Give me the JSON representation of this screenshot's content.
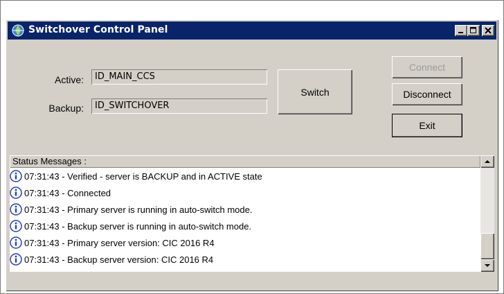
{
  "window": {
    "title": "Switchover Control Panel"
  },
  "titlebar_buttons": {
    "minimize": "minimize",
    "maximize": "maximize",
    "close": "close"
  },
  "form": {
    "active_label": "Active:",
    "active_value": "ID_MAIN_CCS",
    "backup_label": "Backup:",
    "backup_value": "ID_SWITCHOVER"
  },
  "buttons": {
    "switch": "Switch",
    "connect": "Connect",
    "disconnect": "Disconnect",
    "exit": "Exit"
  },
  "status": {
    "header": "Status Messages :",
    "messages": [
      "07:31:43 - Verified - server is BACKUP and in ACTIVE state",
      "07:31:43 - Connected",
      "07:31:43 - Primary server is running in auto-switch mode.",
      "07:31:43 - Backup server is running in auto-switch mode.",
      "07:31:43 - Primary server version: CIC 2016 R4",
      "07:31:43 - Backup server version: CIC 2016 R4"
    ]
  },
  "icons": {
    "app": "network-globe-icon",
    "message": "info-icon"
  },
  "colors": {
    "titlebar": "#0a246a",
    "face": "#d4d0c8",
    "info_icon": "#1f3fbf"
  }
}
